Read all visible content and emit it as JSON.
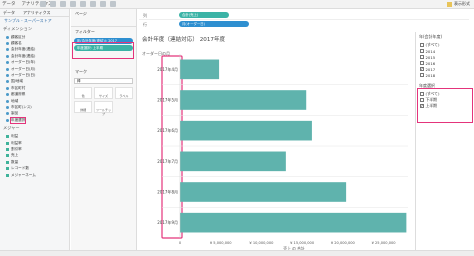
{
  "toolbar": {
    "tabs": [
      "データ",
      "アナリティクス"
    ],
    "showme": "表示形式"
  },
  "left": {
    "datasource": "サンプル - スーパーストア",
    "dim_title": "ディメンション",
    "dimensions": [
      "顧客区分",
      "顧客名",
      "会計年度(連結)",
      "会計年度(連結)",
      "オーダー日(年)",
      "オーダー日(月)",
      "オーダー日(日)",
      "国/地域",
      "市区町村",
      "都道府県",
      "地域",
      "市区町(ンス)",
      "製品"
    ],
    "highlight_field": "年度選択",
    "meas_title": "メジャー",
    "measures": [
      "利益",
      "利益率",
      "割引率",
      "売上",
      "数量",
      "レコード数",
      "メジャーネーム"
    ]
  },
  "shelves": {
    "pages": "ページ",
    "filters": "フィルター",
    "filter_pills": [
      "年(会計年度(連結)): 2017",
      "年度選択: 上半期"
    ],
    "marks": "マーク",
    "marks_type": "棒",
    "marks_cards": [
      "色",
      "サイズ",
      "ラベル",
      "詳細",
      "ツールチップ"
    ],
    "columns_label": "列",
    "columns_pill": "合計(売上)",
    "rows_label": "行",
    "rows_pill": "月(オーダー日)"
  },
  "viz": {
    "title": "会計年度（連結対応） 2017年度",
    "row_header": "オーダー日の月"
  },
  "chart_data": {
    "type": "bar",
    "orientation": "horizontal",
    "categories": [
      "2017年4月",
      "2017年5月",
      "2017年6月",
      "2017年7月",
      "2017年8月",
      "2017年9月"
    ],
    "values": [
      4800000,
      15500000,
      16200000,
      13000000,
      20400000,
      27800000
    ],
    "xlim": [
      0,
      28000000
    ],
    "xticks": [
      "0",
      "¥ 5,000,000",
      "¥ 10,000,000",
      "¥ 15,000,000",
      "¥ 20,000,000",
      "¥ 25,000,000"
    ],
    "xlabel": "売上 の 合計",
    "bar_color": "#5fb3ad"
  },
  "right": {
    "fiscal_title": "年(会計年度)",
    "fiscal_items": [
      {
        "label": "(すべて)",
        "checked": false
      },
      {
        "label": "2014",
        "checked": false
      },
      {
        "label": "2015",
        "checked": false
      },
      {
        "label": "2016",
        "checked": false
      },
      {
        "label": "2017",
        "checked": true
      },
      {
        "label": "2018",
        "checked": false
      }
    ],
    "half_title": "年度選択",
    "half_items": [
      {
        "label": "(すべて)",
        "checked": false
      },
      {
        "label": "下半期",
        "checked": false
      },
      {
        "label": "上半期",
        "checked": true
      }
    ]
  },
  "colors": {
    "accent": "#e4347b",
    "bar": "#5fb3ad",
    "pill_blue": "#2e8fd0",
    "pill_green": "#3bb3a6"
  }
}
